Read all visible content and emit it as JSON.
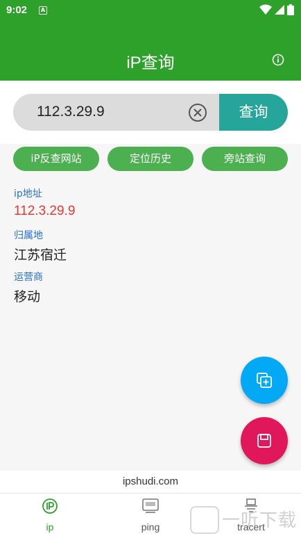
{
  "status_bar": {
    "time": "9:02",
    "notif_letter": "A"
  },
  "app_bar": {
    "title": "iP查询",
    "info_icon": "info-icon"
  },
  "search": {
    "value": "112.3.29.9",
    "clear_icon": "clear-circle-icon",
    "button_label": "查询"
  },
  "actions": [
    {
      "label": "iP反查网站"
    },
    {
      "label": "定位历史"
    },
    {
      "label": "旁站查询"
    }
  ],
  "result": {
    "ip_label": "ip地址",
    "ip_value": "112.3.29.9",
    "location_label": "归属地",
    "location_value": "江苏宿迁",
    "isp_label": "运营商",
    "isp_value": "移动"
  },
  "fabs": {
    "add_icon": "add-copy-icon",
    "save_icon": "save-icon"
  },
  "footer": {
    "url": "ipshudi.com"
  },
  "bottom_nav": [
    {
      "label": "ip",
      "icon": "ip-icon",
      "active": true
    },
    {
      "label": "ping",
      "icon": "ping-icon",
      "active": false
    },
    {
      "label": "tracert",
      "icon": "tracert-icon",
      "active": false
    }
  ],
  "watermark": {
    "text": "一听下载"
  },
  "colors": {
    "primary": "#2ea12a",
    "accent": "#26a69a",
    "pill": "#4caf50",
    "label_blue": "#2a6fd0",
    "ip_red": "#e53935",
    "fab_blue": "#03a9f4",
    "fab_red": "#e0185b"
  }
}
